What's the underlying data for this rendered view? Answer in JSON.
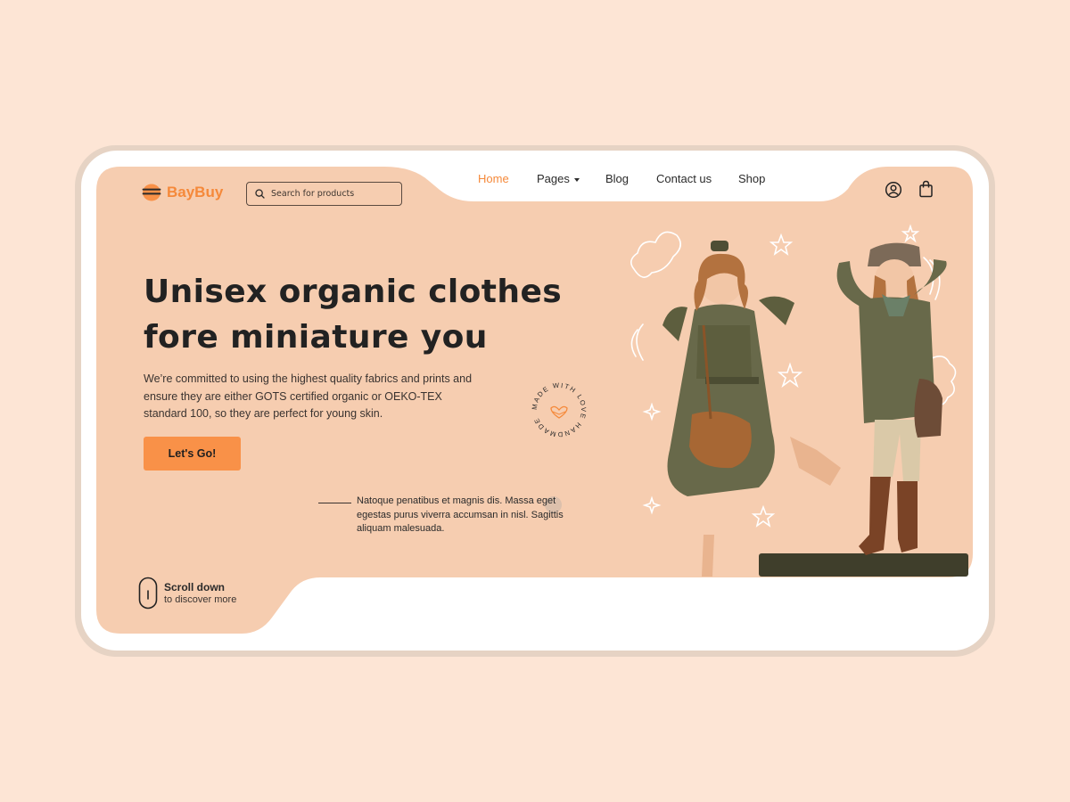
{
  "brand": {
    "name": "BayBuy",
    "logo_icon": "hamburger-logo-icon",
    "color": "#f5893a"
  },
  "search": {
    "placeholder": "Search for products",
    "icon": "search-icon"
  },
  "nav": {
    "items": [
      {
        "label": "Home",
        "active": true
      },
      {
        "label": "Pages",
        "has_dropdown": true
      },
      {
        "label": "Blog"
      },
      {
        "label": "Contact us"
      },
      {
        "label": "Shop"
      }
    ]
  },
  "header_icons": [
    "user-icon",
    "shopping-bag-icon"
  ],
  "hero": {
    "title_line1": "Unisex organic clothes",
    "title_line2": "fore miniature you",
    "description": "We’re committed to using the highest quality fabrics and prints and ensure they are either GOTS certified organic or OEKO-TEX standard 100, so they are perfect for young skin.",
    "cta_label": "Let's Go!",
    "note": "Natoque penatibus et magnis dis. Massa eget egestas purus viverra accumsan in nisl. Sagittis aliquam malesuada.",
    "badge_text": "MADE WITH LOVE HANDMADE"
  },
  "scroll": {
    "title": "Scroll down",
    "subtitle": "to discover more",
    "icon": "mouse-icon"
  },
  "colors": {
    "page_bg": "#fde5d5",
    "hero_bg": "#f6cdb0",
    "accent": "#f99148",
    "text": "#222222"
  }
}
